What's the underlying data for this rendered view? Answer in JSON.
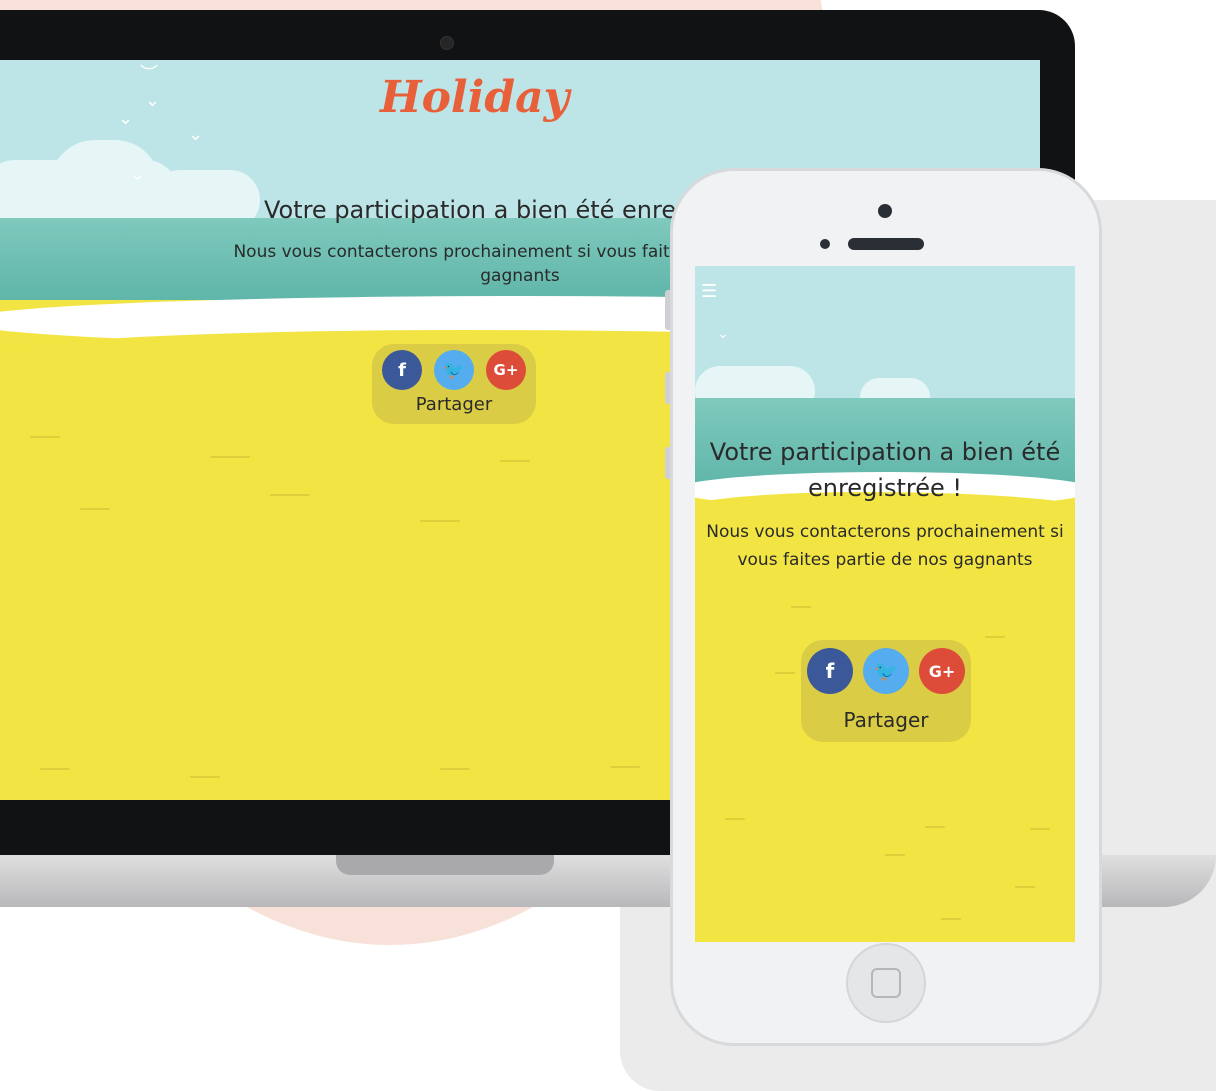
{
  "colors": {
    "brand": "#e8603a",
    "sand": "#f2e543",
    "sky": "#bde5e8",
    "sea": "#6bbdb1",
    "facebook": "#3b5998",
    "twitter": "#55acee",
    "googleplus": "#dd4b39"
  },
  "laptop": {
    "brand": "Holiday",
    "title": "Votre participation a bien été enregistrée !",
    "message_line1": "Nous vous contacterons prochainement si vous faites partie de nos",
    "message_line2": "gagnants",
    "share": {
      "facebook": "f",
      "twitter": "🐦",
      "googleplus": "G+",
      "label": "Partager"
    }
  },
  "phone": {
    "menu_icon": "☰",
    "title_line1": "Votre participation a bien été",
    "title_line2": "enregistrée !",
    "message_line1": "Nous vous contacterons prochainement si",
    "message_line2": "vous faites partie de nos gagnants",
    "share": {
      "facebook": "f",
      "twitter": "🐦",
      "googleplus": "G+",
      "label": "Partager"
    }
  }
}
